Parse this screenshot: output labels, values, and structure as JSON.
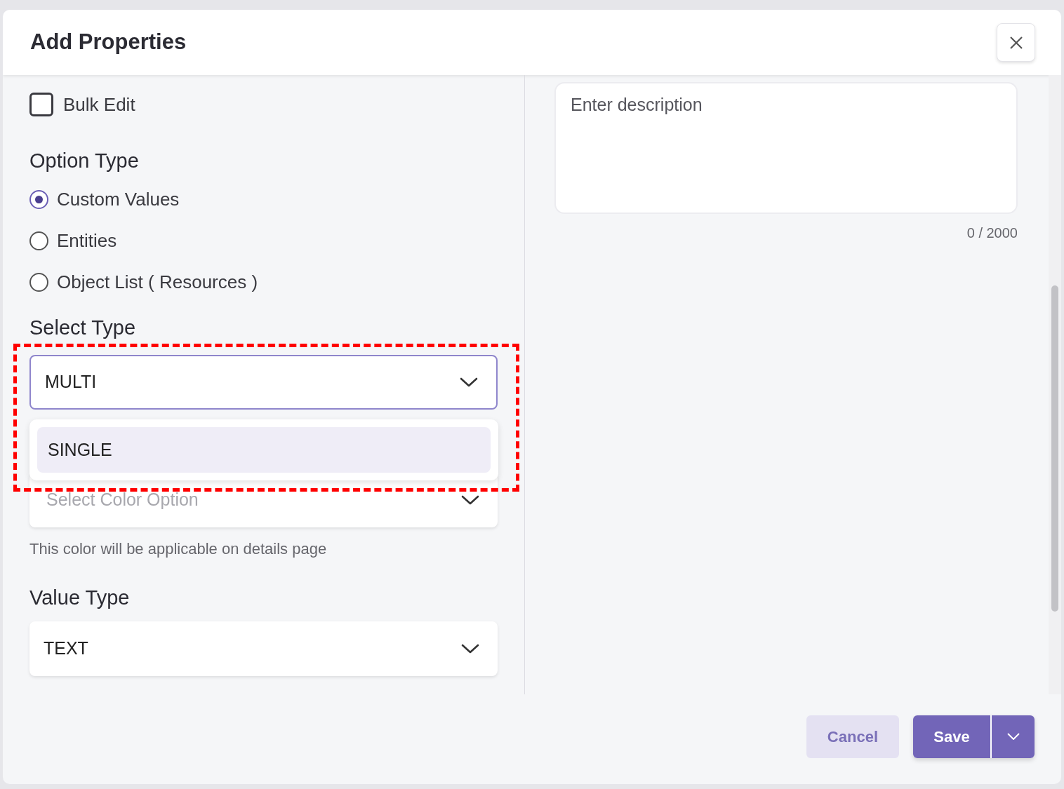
{
  "dialog": {
    "title": "Add Properties"
  },
  "bulk_edit": {
    "label": "Bulk Edit",
    "checked": false
  },
  "option_type": {
    "label": "Option Type",
    "options": [
      {
        "label": "Custom Values",
        "selected": true
      },
      {
        "label": "Entities",
        "selected": false
      },
      {
        "label": "Object List ( Resources )",
        "selected": false
      }
    ]
  },
  "select_type": {
    "label": "Select Type",
    "value": "MULTI",
    "expanded": true,
    "highlighted_by_annotation": true,
    "menu_items": [
      {
        "label": "SINGLE",
        "highlighted": true
      }
    ]
  },
  "color_option": {
    "placeholder": "Select Color Option",
    "hint": "This color will be applicable on details page"
  },
  "value_type": {
    "label": "Value Type",
    "value": "TEXT"
  },
  "description": {
    "placeholder": "Enter description",
    "counter": "0 / 2000"
  },
  "buttons": [
    {
      "kind": "secondary",
      "label": "Cancel"
    },
    {
      "kind": "split",
      "label": "Save"
    }
  ]
}
